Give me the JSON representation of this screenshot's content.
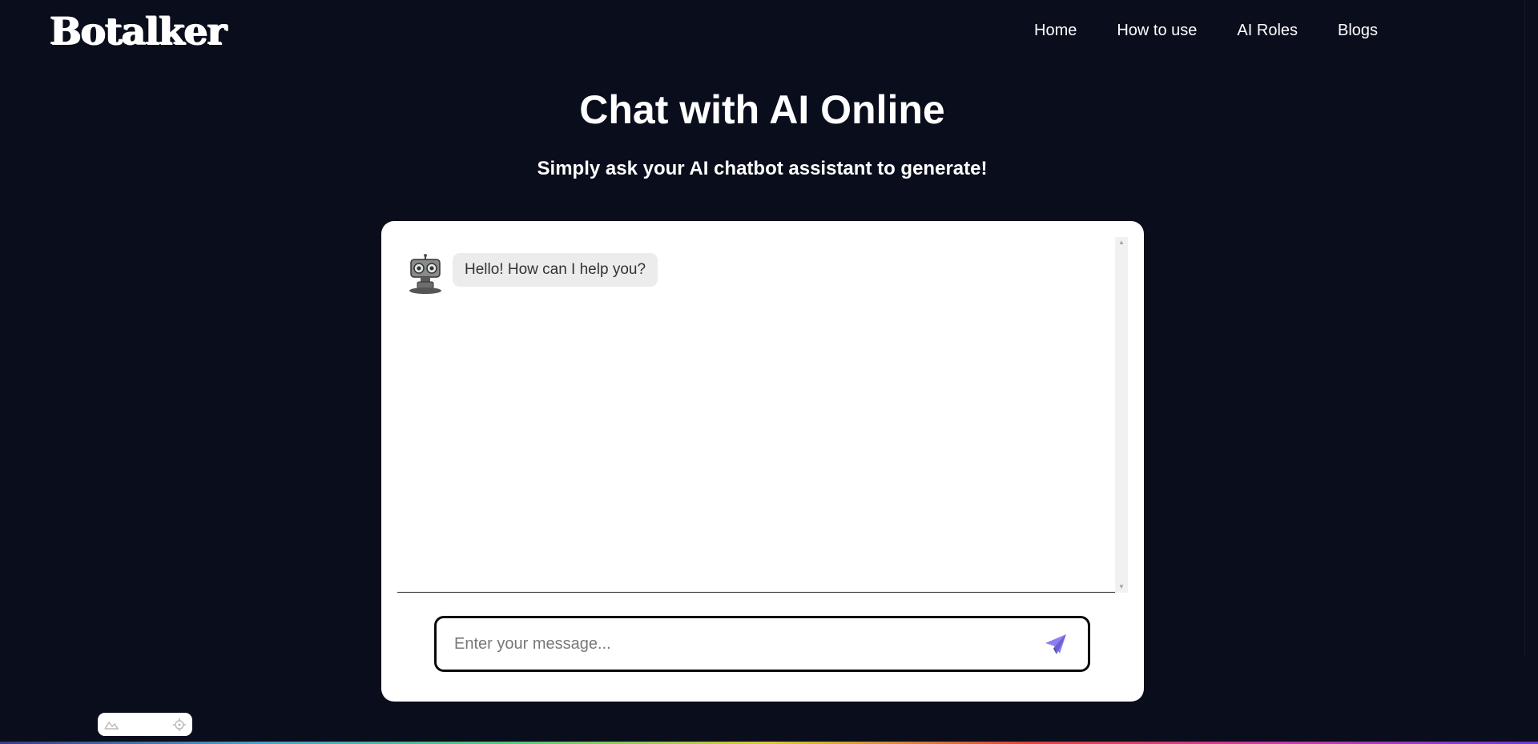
{
  "header": {
    "logo_text": "Botalker",
    "nav": [
      {
        "label": "Home"
      },
      {
        "label": "How to use"
      },
      {
        "label": "AI Roles"
      },
      {
        "label": "Blogs"
      }
    ]
  },
  "main": {
    "title": "Chat with AI Online",
    "subtitle": "Simply ask your AI chatbot assistant to generate!"
  },
  "chat": {
    "messages": [
      {
        "sender": "bot",
        "avatar_icon": "robot-icon",
        "text": "Hello! How can I help you?"
      }
    ],
    "input": {
      "placeholder": "Enter your message...",
      "value": ""
    },
    "send_icon": "paper-plane-icon"
  },
  "colors": {
    "background": "#0a0d1c",
    "card": "#ffffff",
    "accent": "#8b7ff0"
  }
}
